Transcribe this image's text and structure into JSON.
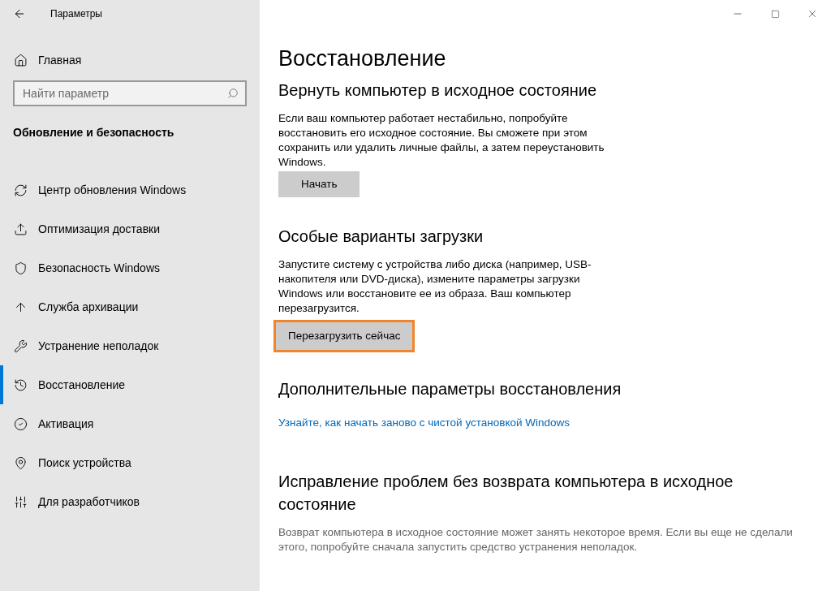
{
  "window": {
    "title": "Параметры"
  },
  "sidebar": {
    "home": "Главная",
    "search": {
      "placeholder": "Найти параметр"
    },
    "section": "Обновление и безопасность",
    "items": [
      {
        "label": "Центр обновления Windows",
        "selected": false
      },
      {
        "label": "Оптимизация доставки",
        "selected": false
      },
      {
        "label": "Безопасность Windows",
        "selected": false
      },
      {
        "label": "Служба архивации",
        "selected": false
      },
      {
        "label": "Устранение неполадок",
        "selected": false
      },
      {
        "label": "Восстановление",
        "selected": true
      },
      {
        "label": "Активация",
        "selected": false
      },
      {
        "label": "Поиск устройства",
        "selected": false
      },
      {
        "label": "Для разработчиков",
        "selected": false
      }
    ]
  },
  "page": {
    "title": "Восстановление",
    "sections": [
      {
        "heading": "Вернуть компьютер в исходное состояние",
        "text": "Если ваш компьютер работает нестабильно, попробуйте восстановить его исходное состояние. Вы сможете при этом сохранить или удалить личные файлы, а затем переустановить Windows.",
        "button": {
          "label": "Начать",
          "highlighted": false
        }
      },
      {
        "heading": "Особые варианты загрузки",
        "text": "Запустите систему с устройства либо диска (например, USB-накопителя или DVD-диска), измените параметры загрузки Windows или восстановите ее из образа. Ваш компьютер перезагрузится.",
        "button": {
          "label": "Перезагрузить сейчас",
          "highlighted": true
        }
      },
      {
        "heading": "Дополнительные параметры восстановления",
        "link": "Узнайте, как начать заново с чистой установкой Windows"
      },
      {
        "heading": "Исправление проблем без возврата компьютера в исходное состояние",
        "text": "Возврат компьютера в исходное состояние может занять некоторое время. Если вы еще не сделали этого, попробуйте сначала запустить средство устранения неполадок."
      }
    ]
  }
}
